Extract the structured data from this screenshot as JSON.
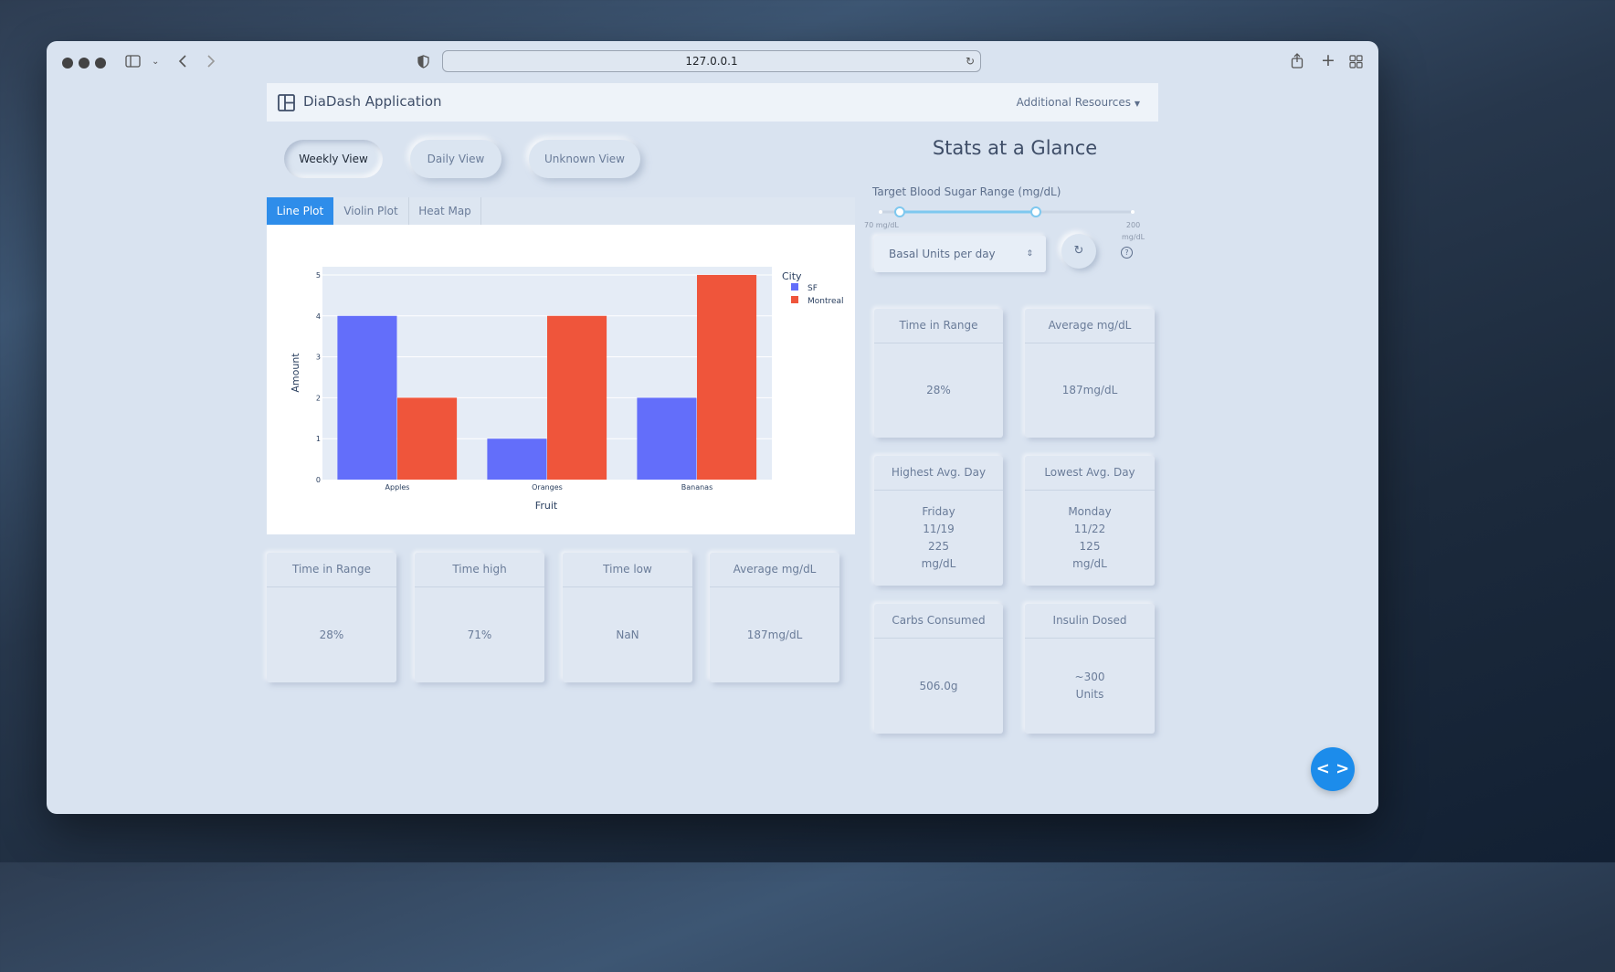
{
  "browser": {
    "url": "127.0.0.1"
  },
  "navbar": {
    "brand": "DiaDash Application",
    "resources_label": "Additional Resources"
  },
  "views": [
    {
      "label": "Weekly View"
    },
    {
      "label": "Daily View"
    },
    {
      "label": "Unknown View"
    }
  ],
  "plot_tabs": [
    {
      "label": "Line Plot"
    },
    {
      "label": "Violin Plot"
    },
    {
      "label": "Heat Map"
    }
  ],
  "chart_data": {
    "type": "bar",
    "categories": [
      "Apples",
      "Oranges",
      "Bananas"
    ],
    "series": [
      {
        "name": "SF",
        "values": [
          4,
          1,
          2
        ],
        "color": "#636efa"
      },
      {
        "name": "Montreal",
        "values": [
          2,
          4,
          5
        ],
        "color": "#ef553b"
      }
    ],
    "xlabel": "Fruit",
    "ylabel": "Amount",
    "ylim": [
      0,
      5.2
    ],
    "yticks": [
      "0",
      "1",
      "2",
      "3",
      "4",
      "5"
    ],
    "legend_title": "City",
    "legend_position": "top-right",
    "grid": true
  },
  "bottom_cards": [
    {
      "title": "Time in Range",
      "value": "28%"
    },
    {
      "title": "Time high",
      "value": "71%"
    },
    {
      "title": "Time low",
      "value": "NaN"
    },
    {
      "title": "Average mg/dL",
      "value": "187mg/dL"
    }
  ],
  "stats": {
    "title": "Stats at a Glance",
    "slider_label": "Target Blood Sugar Range (mg/dL)",
    "slider_min_label": "70 mg/dL",
    "slider_max_value": "200",
    "slider_max_unit": "mg/dL",
    "basal_placeholder": "Basal Units per day",
    "cards": [
      {
        "title": "Time in Range",
        "value": "28%"
      },
      {
        "title": "Average mg/dL",
        "value": "187mg/dL"
      },
      {
        "title": "Highest Avg. Day",
        "value": "Friday\n11/19\n225\nmg/dL"
      },
      {
        "title": "Lowest Avg. Day",
        "value": "Monday\n11/22\n125\nmg/dL"
      },
      {
        "title": "Carbs Consumed",
        "value": "506.0g"
      },
      {
        "title": "Insulin Dosed",
        "value": "~300\nUnits"
      }
    ]
  },
  "colors": {
    "accent": "#2e8dea",
    "fab": "#1c8ceb",
    "sf": "#636efa",
    "montreal": "#ef553b"
  }
}
